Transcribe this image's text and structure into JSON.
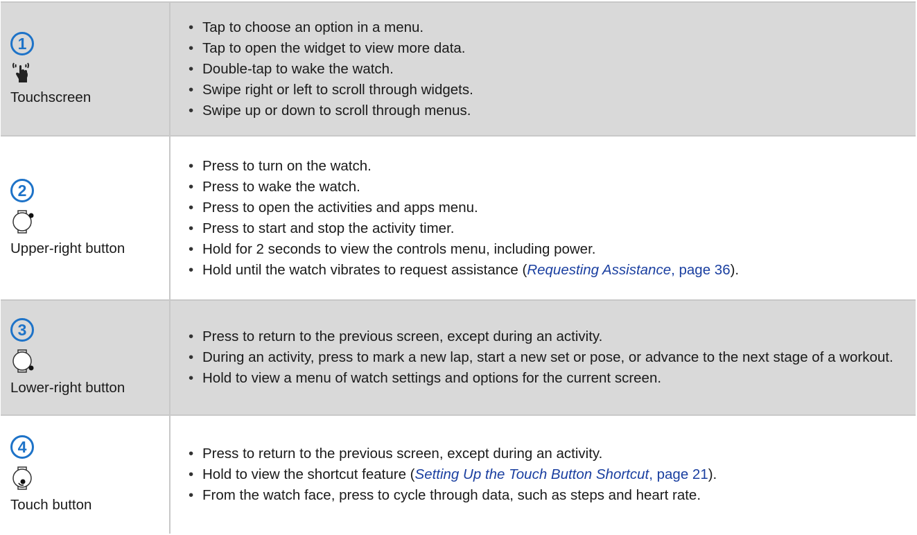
{
  "rows": [
    {
      "number": "1",
      "icon": "touch-hand-icon",
      "label": "Touchscreen",
      "items": [
        "Tap to choose an option in a menu.",
        "Tap to open the widget to view more data.",
        "Double-tap to wake the watch.",
        "Swipe right or left to scroll through widgets.",
        "Swipe up or down to scroll through menus."
      ]
    },
    {
      "number": "2",
      "icon": "upper-right-button-icon",
      "label": "Upper-right button",
      "items": [
        "Press to turn on the watch.",
        "Press to wake the watch.",
        "Press to open the activities and apps menu.",
        "Press to start and stop the activity timer.",
        "Hold for 2 seconds to view the controls menu, including power."
      ],
      "last": {
        "pre": "Hold until the watch vibrates to request assistance (",
        "link_title": "Requesting Assistance",
        "link_page": ", page 36",
        "post": ")."
      }
    },
    {
      "number": "3",
      "icon": "lower-right-button-icon",
      "label": "Lower-right button",
      "items": [
        "Press to return to the previous screen, except during an activity.",
        "During an activity, press to mark a new lap, start a new set or pose, or advance to the next stage of a workout.",
        "Hold to view a menu of watch settings and options for the current screen."
      ]
    },
    {
      "number": "4",
      "icon": "touch-button-icon",
      "label": "Touch button",
      "items": [
        "Press to return to the previous screen, except during an activity."
      ],
      "mid": {
        "pre": "Hold to view the shortcut feature (",
        "link_title": "Setting Up the Touch Button Shortcut",
        "link_page": ", page 21",
        "post": ")."
      },
      "tail": "From the watch face, press to cycle through data, such as steps and heart rate."
    }
  ],
  "colors": {
    "accent": "#1e73c8",
    "link": "#1a3fa0",
    "shade": "#d9d9d9"
  }
}
